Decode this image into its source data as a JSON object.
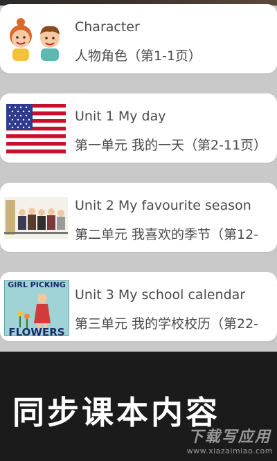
{
  "units": [
    {
      "title": "Character",
      "subtitle": "人物角色（第1-1页）",
      "icon": "characters-icon"
    },
    {
      "title": "Unit 1 My day",
      "subtitle": "第一单元 我的一天（第2-11页）",
      "icon": "us-flag-icon"
    },
    {
      "title": "Unit 2 My favourite season",
      "subtitle": "第二单元 我喜欢的季节（第12-",
      "icon": "people-queue-icon"
    },
    {
      "title": "Unit 3 My school calendar",
      "subtitle": "第三单元 我的学校校历（第22-",
      "icon": "girl-picking-flowers-icon",
      "thumb_text": [
        "GIRL PICKING",
        "FLOWERS"
      ]
    }
  ],
  "banner": {
    "headline": "同步课本内容",
    "watermark_main": "下载写应用",
    "watermark_url": "www.xiazaimiao.com"
  },
  "colors": {
    "banner_bg": "#1b1b1b",
    "card_bg": "#ffffff",
    "page_bg": "#c9c9c9",
    "text": "#4a4a4a"
  }
}
